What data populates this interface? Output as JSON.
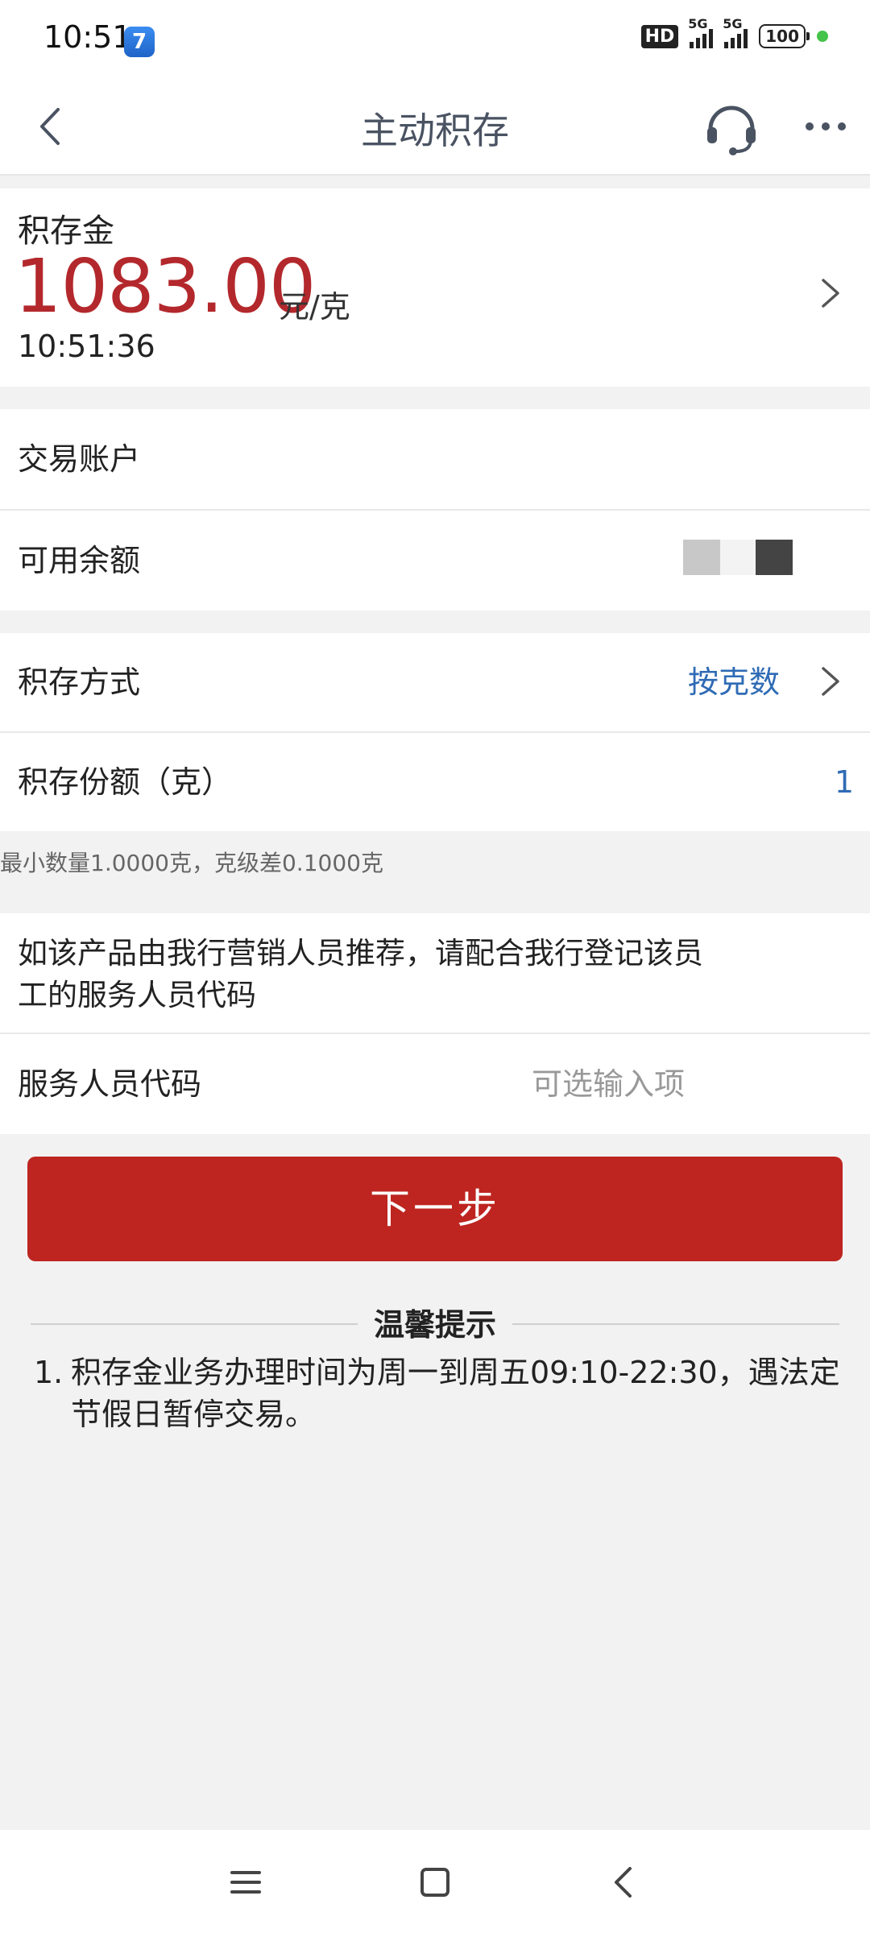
{
  "status_bar": {
    "time": "10:51",
    "app_icon": "7",
    "hd_label": "HD",
    "network1": "5G",
    "network2": "5G",
    "battery": "100"
  },
  "nav": {
    "title": "主动积存",
    "back_icon": "chevron-left-icon",
    "service_icon": "headset-icon",
    "more_icon": "more-dots-icon"
  },
  "price_card": {
    "label": "积存金",
    "price": "1083.00",
    "unit": "元/克",
    "time": "10:51:36"
  },
  "account": {
    "label": "交易账户"
  },
  "balance": {
    "label": "可用余额"
  },
  "method": {
    "label": "积存方式",
    "value": "按克数"
  },
  "amount": {
    "label": "积存份额（克）",
    "value": "1"
  },
  "hint": "最小数量1.0000克，克级差0.1000克",
  "notice": "如该产品由我行营销人员推荐，请配合我行登记该员工的服务人员代码",
  "staff": {
    "label": "服务人员代码",
    "placeholder": "可选输入项"
  },
  "next_button": "下一步",
  "tips": {
    "title": "温馨提示",
    "items": [
      {
        "num": "1.",
        "text": "积存金业务办理时间为周一到周五09:10-22:30，遇法定节假日暂停交易。"
      }
    ]
  },
  "colors": {
    "accent_red": "#be2520",
    "price_red": "#b3282c",
    "link_blue": "#2f6bb5"
  }
}
